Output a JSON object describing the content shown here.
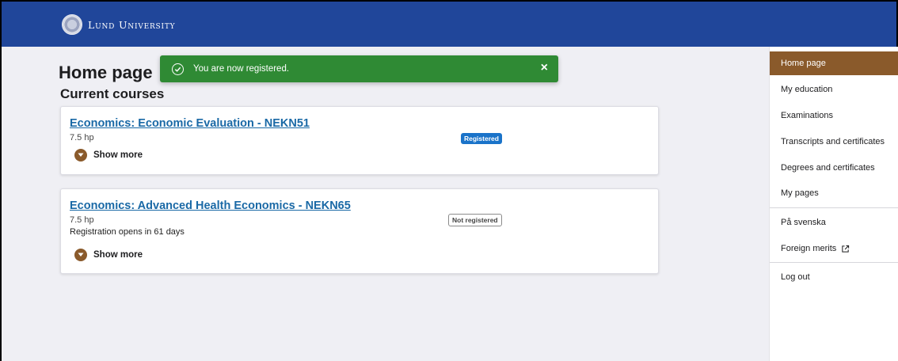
{
  "header": {
    "logo_text": "Lund University"
  },
  "main": {
    "page_title": "Home page",
    "section_title": "Current courses"
  },
  "toast": {
    "message": "You are now registered.",
    "close_label": "×",
    "color": "#2f8a34"
  },
  "courses": [
    {
      "title": "Economics: Economic Evaluation - NEKN51",
      "credits": "7.5 hp",
      "status": "Registered",
      "show_more": "Show more"
    },
    {
      "title": "Economics: Advanced Health Economics - NEKN65",
      "credits": "7.5 hp",
      "registration_note": "Registration opens in 61 days",
      "status": "Not registered",
      "show_more": "Show more"
    }
  ],
  "sidebar": {
    "items": [
      {
        "label": "Home page",
        "active": true
      },
      {
        "label": "My education"
      },
      {
        "label": "Examinations"
      },
      {
        "label": "Transcripts and certificates"
      },
      {
        "label": "Degrees and certificates"
      },
      {
        "label": "My pages"
      },
      {
        "label": "På svenska"
      },
      {
        "label": "Foreign merits",
        "icon": "external-link-icon"
      },
      {
        "label": "Log out"
      }
    ]
  },
  "colors": {
    "header_blue": "#20469a",
    "accent_brown": "#8a5a2b",
    "link_blue": "#1a69a6",
    "badge_blue": "#1a73c9"
  }
}
